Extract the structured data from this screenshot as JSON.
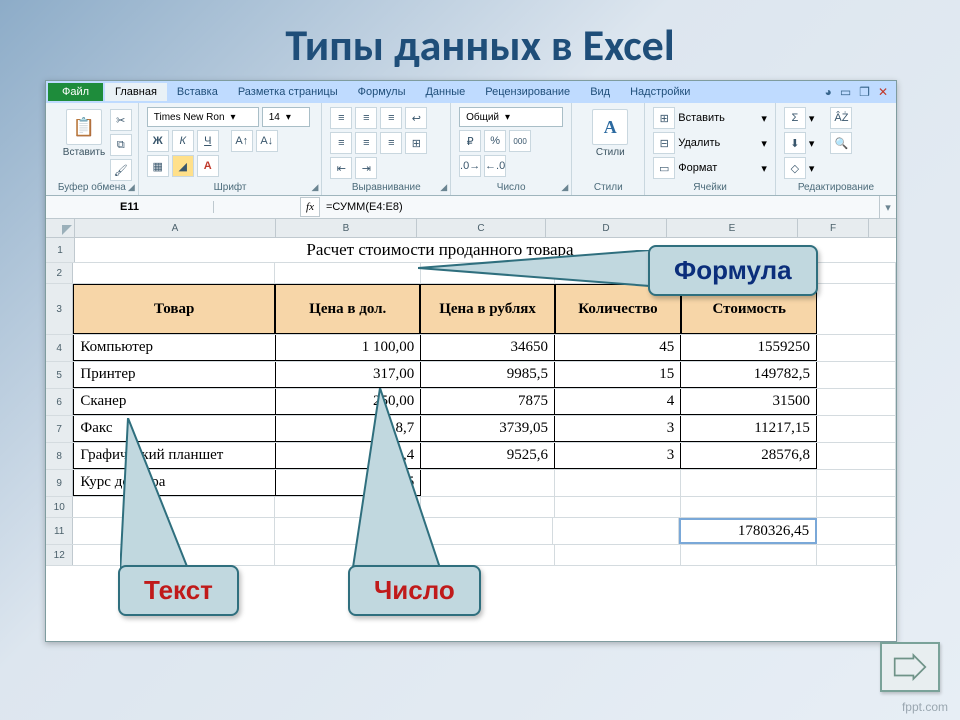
{
  "slide": {
    "title": "Типы данных в Excel",
    "footer": "fppt.com"
  },
  "ribbon": {
    "file": "Файл",
    "tabs": [
      "Главная",
      "Вставка",
      "Разметка страницы",
      "Формулы",
      "Данные",
      "Рецензирование",
      "Вид",
      "Надстройки"
    ],
    "active_tab": 0,
    "groups": {
      "clipboard": {
        "label": "Буфер обмена",
        "paste": "Вставить"
      },
      "font": {
        "label": "Шрифт",
        "name": "Times New Ron",
        "size": "14",
        "bold": "Ж",
        "italic": "К",
        "underline": "Ч"
      },
      "alignment": {
        "label": "Выравнивание"
      },
      "number": {
        "label": "Число",
        "format": "Общий",
        "percent": "%",
        "thousands": "000"
      },
      "styles": {
        "label": "Стили",
        "btn": "Стили"
      },
      "cells": {
        "label": "Ячейки",
        "insert": "Вставить",
        "delete": "Удалить",
        "format": "Формат"
      },
      "editing": {
        "label": "Редактирование"
      }
    }
  },
  "fbar": {
    "name": "E11",
    "formula": "=СУММ(E4:E8)"
  },
  "columns": [
    "A",
    "B",
    "C",
    "D",
    "E",
    "F"
  ],
  "sheet": {
    "title": "Расчет стоимости проданного товара",
    "headers": [
      "Товар",
      "Цена в дол.",
      "Цена в рублях",
      "Количество",
      "Стоимость"
    ],
    "rows": [
      {
        "name": "Компьютер",
        "dol": "1 100,00",
        "rub": "34650",
        "qty": "45",
        "cost": "1559250"
      },
      {
        "name": "Принтер",
        "dol": "317,00",
        "rub": "9985,5",
        "qty": "15",
        "cost": "149782,5"
      },
      {
        "name": "Сканер",
        "dol": "250,00",
        "rub": "7875",
        "qty": "4",
        "cost": "31500"
      },
      {
        "name": "Факс",
        "dol": "118,7",
        "rub": "3739,05",
        "qty": "3",
        "cost": "11217,15"
      },
      {
        "name": "Графический планшет",
        "dol": "302,4",
        "rub": "9525,6",
        "qty": "3",
        "cost": "28576,8"
      }
    ],
    "usd_label": "Курс доллара",
    "usd_value": "31,5",
    "total": "1780326,45"
  },
  "callouts": {
    "formula": "Формула",
    "text": "Текст",
    "number": "Число"
  },
  "chart_data": {
    "type": "table",
    "title": "Расчет стоимости проданного товара",
    "columns": [
      "Товар",
      "Цена в дол.",
      "Цена в рублях",
      "Количество",
      "Стоимость"
    ],
    "rows": [
      [
        "Компьютер",
        1100.0,
        34650,
        45,
        1559250
      ],
      [
        "Принтер",
        317.0,
        9985.5,
        15,
        149782.5
      ],
      [
        "Сканер",
        250.0,
        7875,
        4,
        31500
      ],
      [
        "Факс",
        118.7,
        3739.05,
        3,
        11217.15
      ],
      [
        "Графический планшет",
        302.4,
        9525.6,
        3,
        28576.8
      ]
    ],
    "usd_rate": 31.5,
    "total_cost": 1780326.45
  }
}
